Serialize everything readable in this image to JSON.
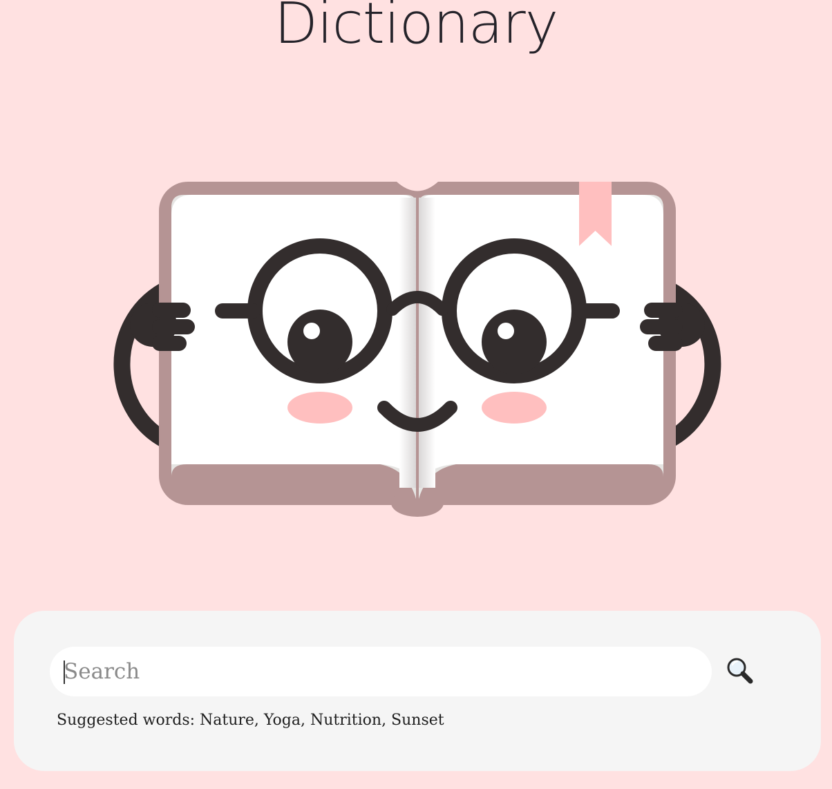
{
  "header": {
    "title": "Dictionary"
  },
  "illustration": {
    "name": "book-with-glasses-illustration",
    "colors": {
      "background": "#ffe1e1",
      "cover": "#b59494",
      "page": "#ffffff",
      "page_edge": "#e6e5e3",
      "ink": "#332d2d",
      "blush": "#ffbfbf",
      "bookmark": "#ffbfbf"
    }
  },
  "search": {
    "placeholder": "Search",
    "value": "",
    "button_icon": "magnifier-icon"
  },
  "suggestions": {
    "text": "Suggested words: Nature, Yoga, Nutrition, Sunset"
  },
  "colors": {
    "page_background": "#ffe1e1",
    "panel_background": "#f5f5f5",
    "title_color": "#25232a"
  }
}
